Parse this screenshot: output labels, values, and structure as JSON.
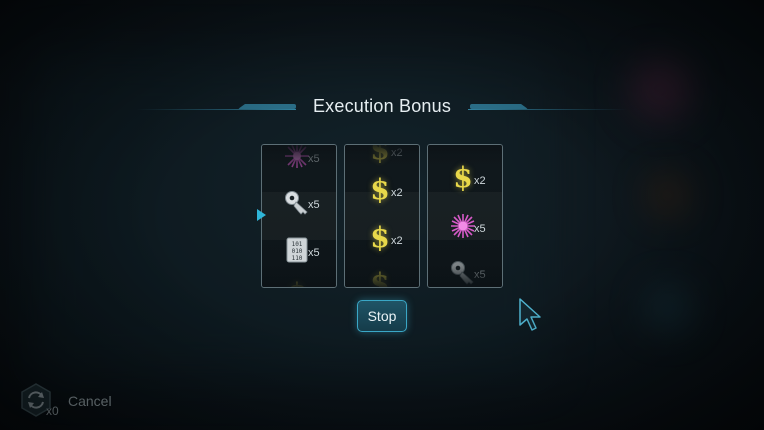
{
  "title": "Execution Bonus",
  "reels": [
    {
      "symbols": [
        {
          "icon": "flower-icon",
          "multiplier": "x5"
        },
        {
          "icon": "key-icon",
          "multiplier": "x5"
        },
        {
          "icon": "binary-chip-icon",
          "multiplier": "x5"
        },
        {
          "icon": "dollar-icon",
          "multiplier": ""
        }
      ]
    },
    {
      "symbols": [
        {
          "icon": "dollar-icon",
          "multiplier": "x2"
        },
        {
          "icon": "dollar-icon",
          "multiplier": "x2"
        },
        {
          "icon": "dollar-icon",
          "multiplier": "x2"
        },
        {
          "icon": "dollar-icon",
          "multiplier": ""
        }
      ]
    },
    {
      "symbols": [
        {
          "icon": "dollar-icon",
          "multiplier": "x2"
        },
        {
          "icon": "flower-icon",
          "multiplier": "x5"
        },
        {
          "icon": "key-icon",
          "multiplier": "x5"
        }
      ]
    }
  ],
  "stop_button": {
    "label": "Stop"
  },
  "cancel": {
    "label": "Cancel",
    "count": "x0"
  },
  "colors": {
    "accent": "#2fb6d8",
    "dollar": "#e8d84a",
    "flower": "#d65ac8"
  }
}
